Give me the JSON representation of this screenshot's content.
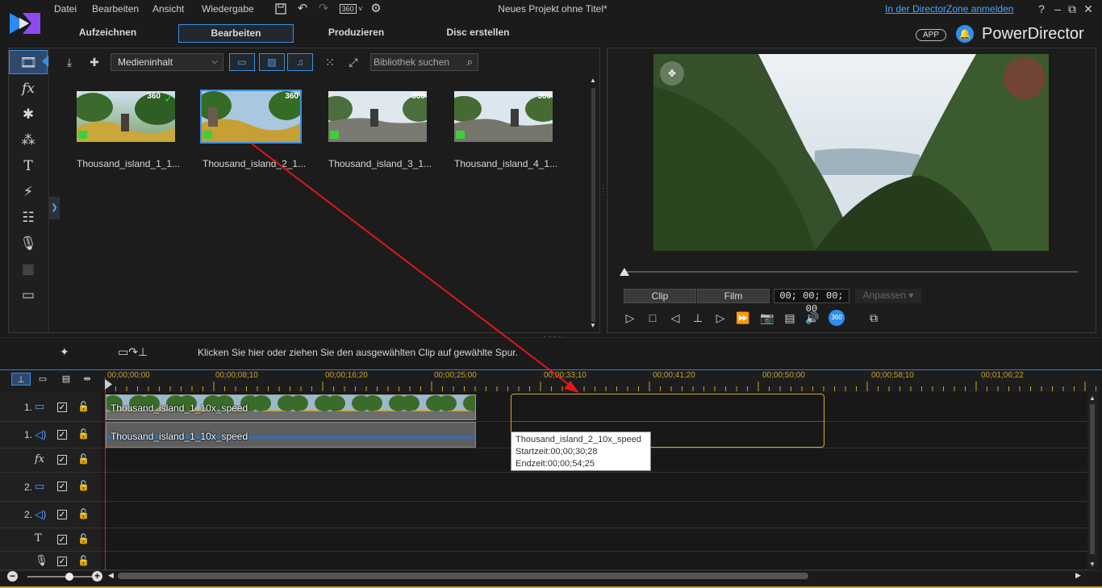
{
  "menu": [
    "Datei",
    "Bearbeiten",
    "Ansicht",
    "Wiedergabe"
  ],
  "toolbar_icons": [
    "save-icon",
    "undo-icon",
    "redo-icon",
    "360-icon",
    "gear-icon"
  ],
  "toolbar_360_label": "360",
  "document_title": "Neues Projekt ohne Titel*",
  "login_link": "In der DirectorZone anmelden",
  "window_buttons": [
    "?",
    "–",
    "⧉",
    "✕"
  ],
  "tabs": [
    {
      "label": "Aufzeichnen",
      "active": false
    },
    {
      "label": "Bearbeiten",
      "active": true
    },
    {
      "label": "Produzieren",
      "active": false
    },
    {
      "label": "Disc erstellen",
      "active": false
    }
  ],
  "app_badge": "APP",
  "brand": "PowerDirector",
  "library": {
    "media_filter": "Medieninhalt",
    "search_placeholder": "Bibliothek suchen",
    "items": [
      {
        "label": "Thousand_island_1_1...",
        "badge": "360",
        "used": true,
        "selected": false
      },
      {
        "label": "Thousand_island_2_1...",
        "badge": "360",
        "used": false,
        "selected": true
      },
      {
        "label": "Thousand_island_3_1...",
        "badge": "360",
        "used": false,
        "selected": false
      },
      {
        "label": "Thousand_island_4_1...",
        "badge": "360",
        "used": false,
        "selected": false
      }
    ]
  },
  "preview": {
    "mode_clip": "Clip",
    "mode_film": "Film",
    "timecode": "00; 00; 00; 00",
    "fit_label": "Anpassen"
  },
  "timeline": {
    "hint": "Klicken Sie hier oder ziehen Sie den ausgewählten Clip auf gewählte Spur.",
    "ruler": [
      "00;00;00;00",
      "00;00;08;10",
      "00;00;16;20",
      "00;00;25;00",
      "00;00;33;10",
      "00;00;41;20",
      "00;00;50;00",
      "00;00;58;10",
      "00;01;06;22"
    ],
    "tracks": [
      {
        "label": "1.",
        "type": "video"
      },
      {
        "label": "1.",
        "type": "audio"
      },
      {
        "label": "",
        "type": "fx"
      },
      {
        "label": "2.",
        "type": "video"
      },
      {
        "label": "2.",
        "type": "audio"
      },
      {
        "label": "",
        "type": "title"
      },
      {
        "label": "",
        "type": "voice"
      }
    ],
    "clip_video_name": "Thousand_island_1_10x_speed",
    "clip_audio_name": "Thousand_island_1_10x_speed",
    "tooltip": {
      "name": "Thousand_island_2_10x_speed",
      "start": "Startzeit:00;00;30;28",
      "end": "Endzeit:00;00;54;25"
    }
  },
  "colors": {
    "accent": "#3b8fe0",
    "ruler_text": "#c9a227",
    "playhead": "#dd2222",
    "drop_zone": "#d6a93a",
    "used_check": "#3cd13c"
  }
}
